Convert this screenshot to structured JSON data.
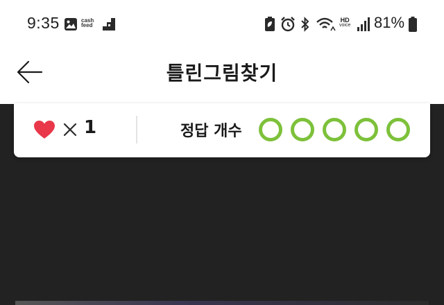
{
  "status_bar": {
    "time": "9:35",
    "notification_icons": [
      "gallery-icon",
      "cash-feed-icon",
      "stairs-app-icon"
    ],
    "cash_feed_label_top": "cash",
    "cash_feed_label_bottom": "feed",
    "system_icons": [
      "battery-saver-icon",
      "alarm-icon",
      "bluetooth-icon",
      "wifi-icon",
      "hd-voice-icon",
      "signal-icon",
      "battery-icon"
    ],
    "hd_label": "HD",
    "voice_label": "voice",
    "battery_percent": "81%"
  },
  "header": {
    "back_icon": "arrow-left-icon",
    "title": "틀린그림찾기"
  },
  "game_status": {
    "lives_icon": "heart-icon",
    "lives_multiplier": "×",
    "lives_count": "1",
    "answer_label": "정답 개수",
    "answer_slots_total": 5,
    "answer_slots_found": 0,
    "slot_color": "#7dc13a",
    "heart_color": "#e8384a"
  },
  "game_area": {
    "background": "#222222"
  }
}
